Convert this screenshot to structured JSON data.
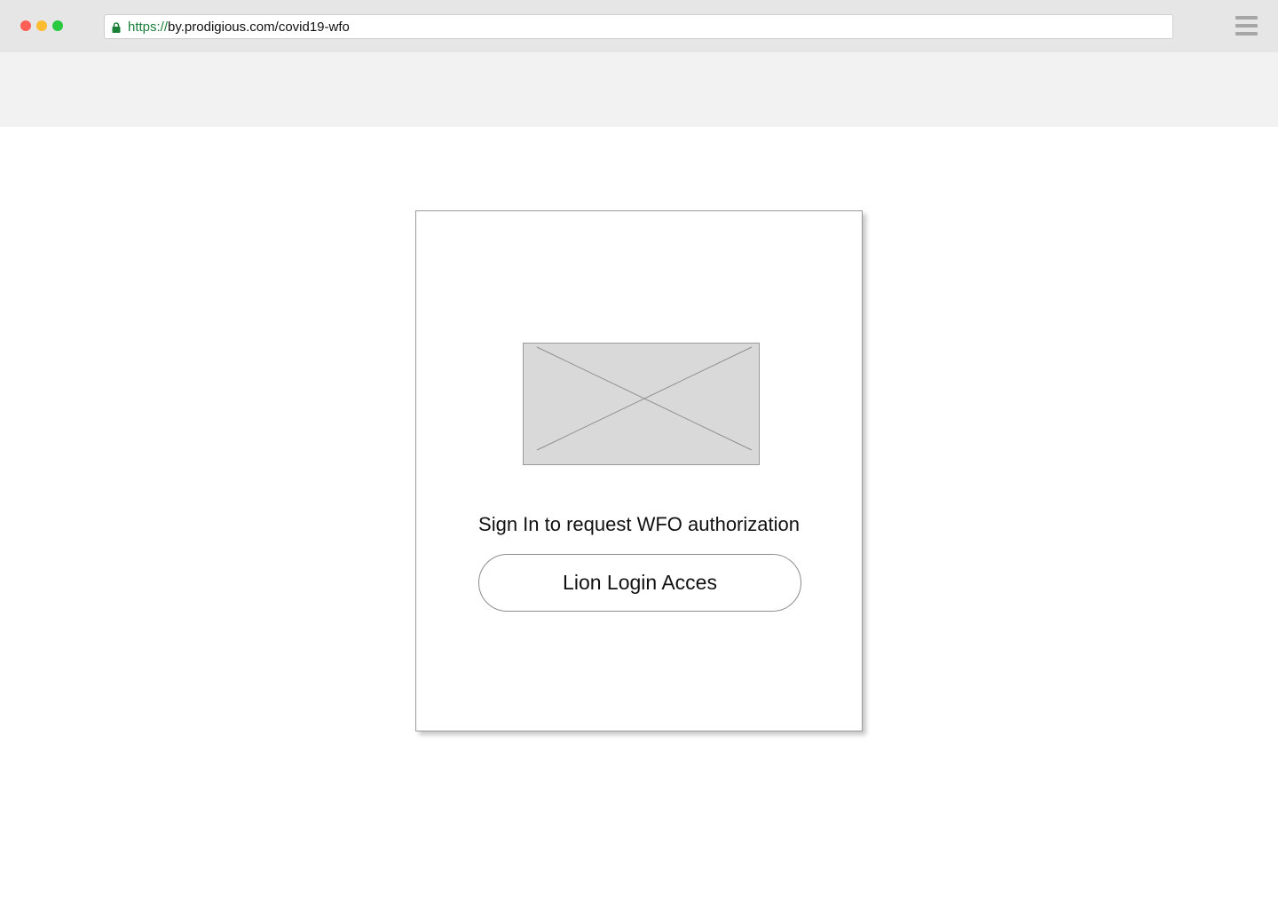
{
  "browser": {
    "url_scheme": "https://",
    "url_rest": "by.prodigious.com/covid19-wfo",
    "lock_icon": "lock-icon",
    "menu_icon": "hamburger-menu-icon"
  },
  "login": {
    "logo_icon": "image-placeholder-icon",
    "prompt": "Sign In to request WFO authorization",
    "button_label": "Lion Login Acces"
  },
  "colors": {
    "browser_bar": "#e6e6e6",
    "page_header": "#f2f2f2",
    "secure_scheme": "#1a7f37",
    "placeholder_fill": "#d9d9d9"
  }
}
